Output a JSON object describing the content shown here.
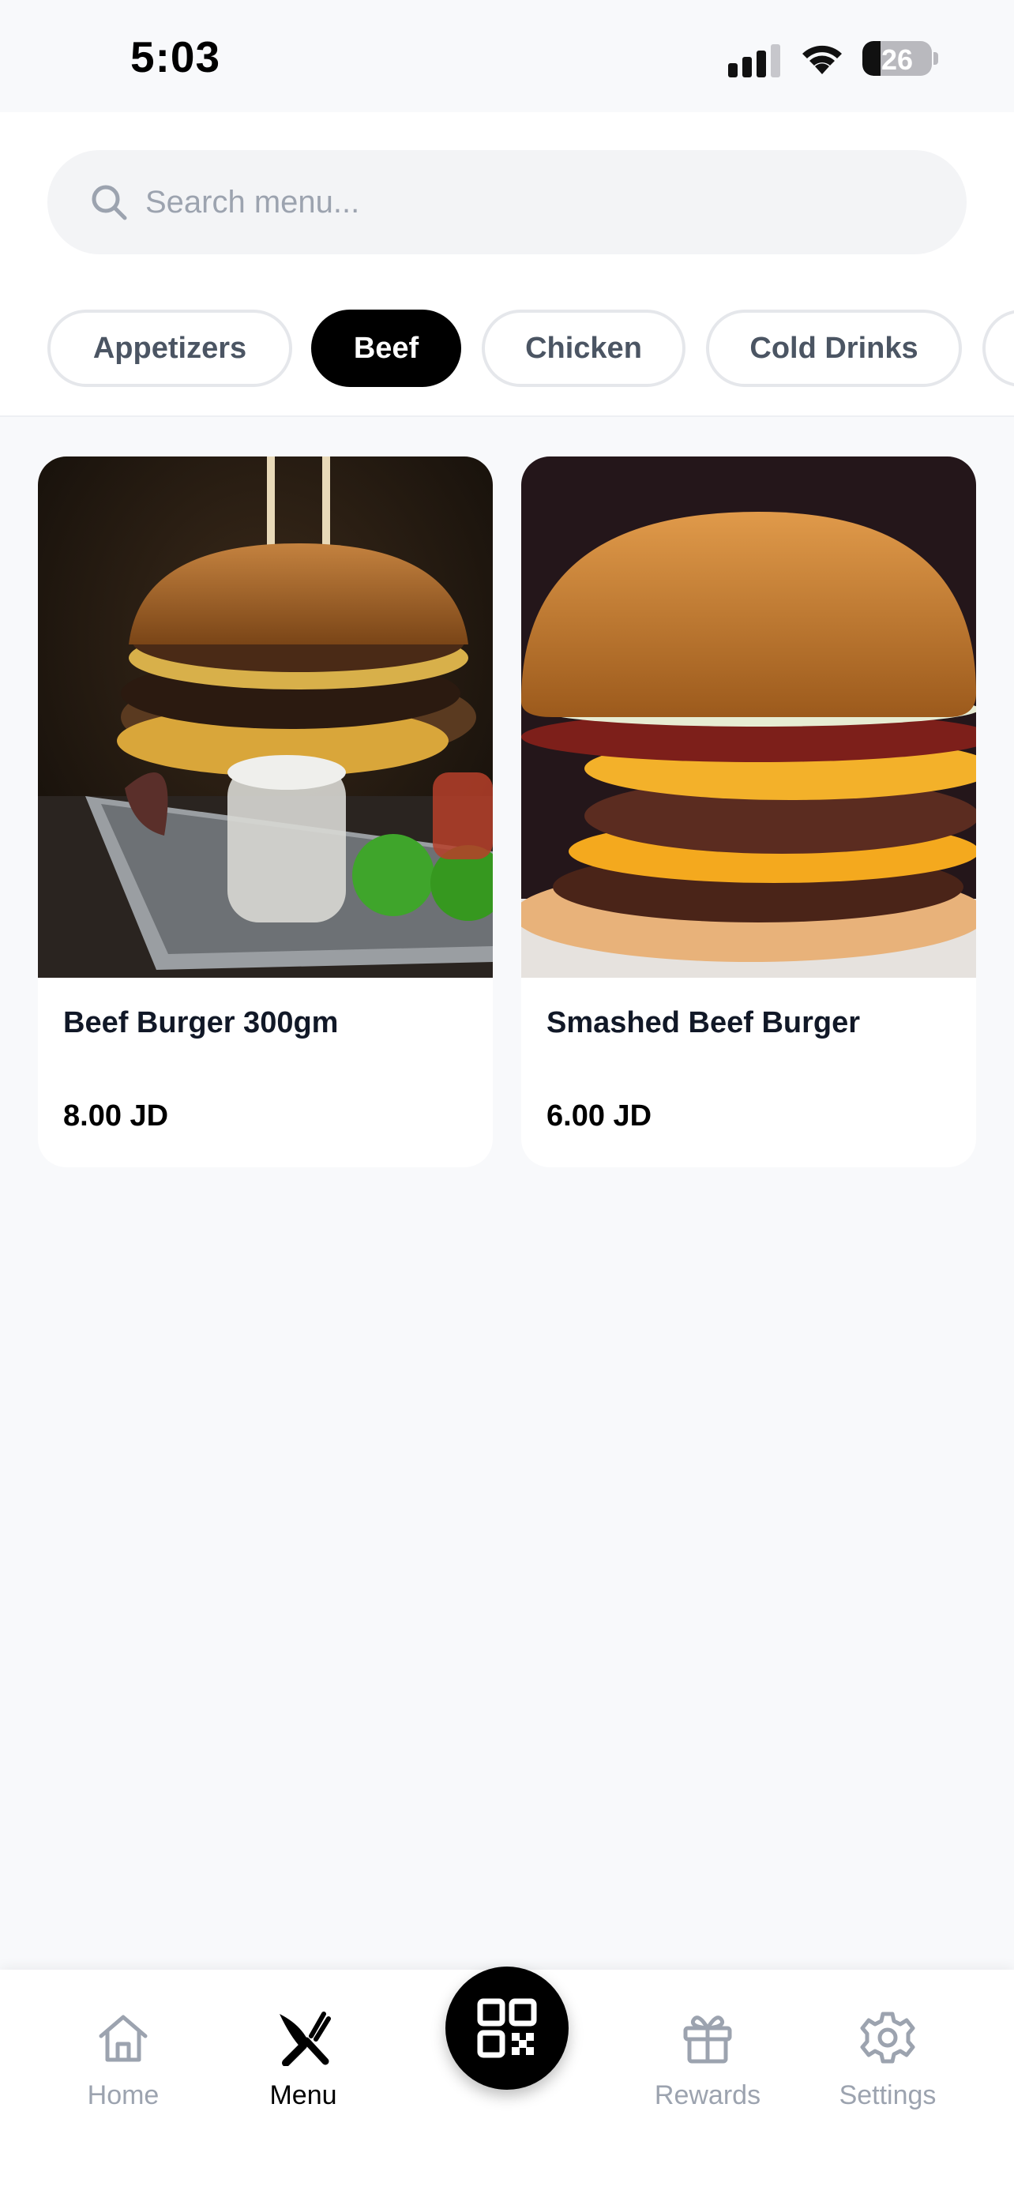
{
  "status_bar": {
    "time": "5:03",
    "battery_level": "26",
    "battery_fraction": 0.26,
    "icons": [
      "signal-icon",
      "wifi-icon",
      "battery-icon"
    ]
  },
  "search": {
    "placeholder": "Search menu...",
    "value": "",
    "icon": "search-icon"
  },
  "categories": {
    "items": [
      {
        "label": "Appetizers",
        "active": false
      },
      {
        "label": "Beef",
        "active": true
      },
      {
        "label": "Chicken",
        "active": false
      },
      {
        "label": "Cold Drinks",
        "active": false
      }
    ]
  },
  "products": [
    {
      "name": "Beef Burger 300gm",
      "price": "8.00 JD"
    },
    {
      "name": "Smashed Beef Burger",
      "price": "6.00 JD"
    }
  ],
  "nav": {
    "home": {
      "label": "Home",
      "icon": "home-icon"
    },
    "menu": {
      "label": "Menu",
      "icon": "fork-knife-icon"
    },
    "scan": {
      "icon": "qr-code-icon"
    },
    "rewards": {
      "label": "Rewards",
      "icon": "gift-icon"
    },
    "settings": {
      "label": "Settings",
      "icon": "gear-icon"
    }
  },
  "colors": {
    "active_chip": "#000000",
    "inactive_text": "#9ca3af",
    "background": "#f8f9fb"
  }
}
